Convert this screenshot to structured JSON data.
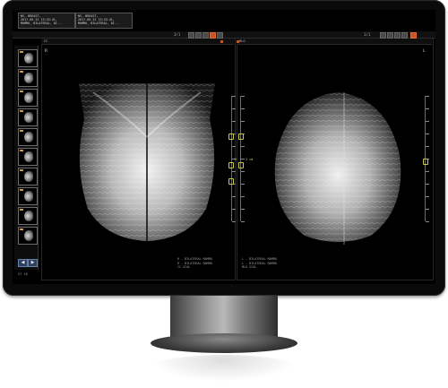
{
  "header": {
    "patient_left": [
      "NS, BREAST,",
      "2017-05-12 13:25:41,",
      "MAMMO, BILATERAL, DI..."
    ],
    "patient_right": [
      "NS, BREAST,",
      "2017-05-12 13:25:41,",
      "MAMMO, BILATERAL, DI..."
    ]
  },
  "toolbar": {
    "zoom_label": "3/1",
    "page_label": "1/1"
  },
  "viewports": {
    "left": {
      "tab": "CC",
      "orientation": "R",
      "annotation": "3 cm",
      "footer": [
        "R - BILATERAL MAMMO",
        "R - BILATERAL MAMMO",
        "CC  SCAL"
      ]
    },
    "right": {
      "tab": "MLO",
      "orientation": "L",
      "annotation": "3 cm",
      "footer": [
        "L - BILATERAL MAMMO",
        "L - BILATERAL MAMMO",
        "MLO  SCAL"
      ]
    }
  },
  "sidebar": {
    "nav_prev": "◀",
    "nav_next": "▶",
    "status": "ST 10"
  },
  "colors": {
    "accent": "#c0542a",
    "marker": "#c8c850",
    "nav": "#2f3f5f"
  }
}
